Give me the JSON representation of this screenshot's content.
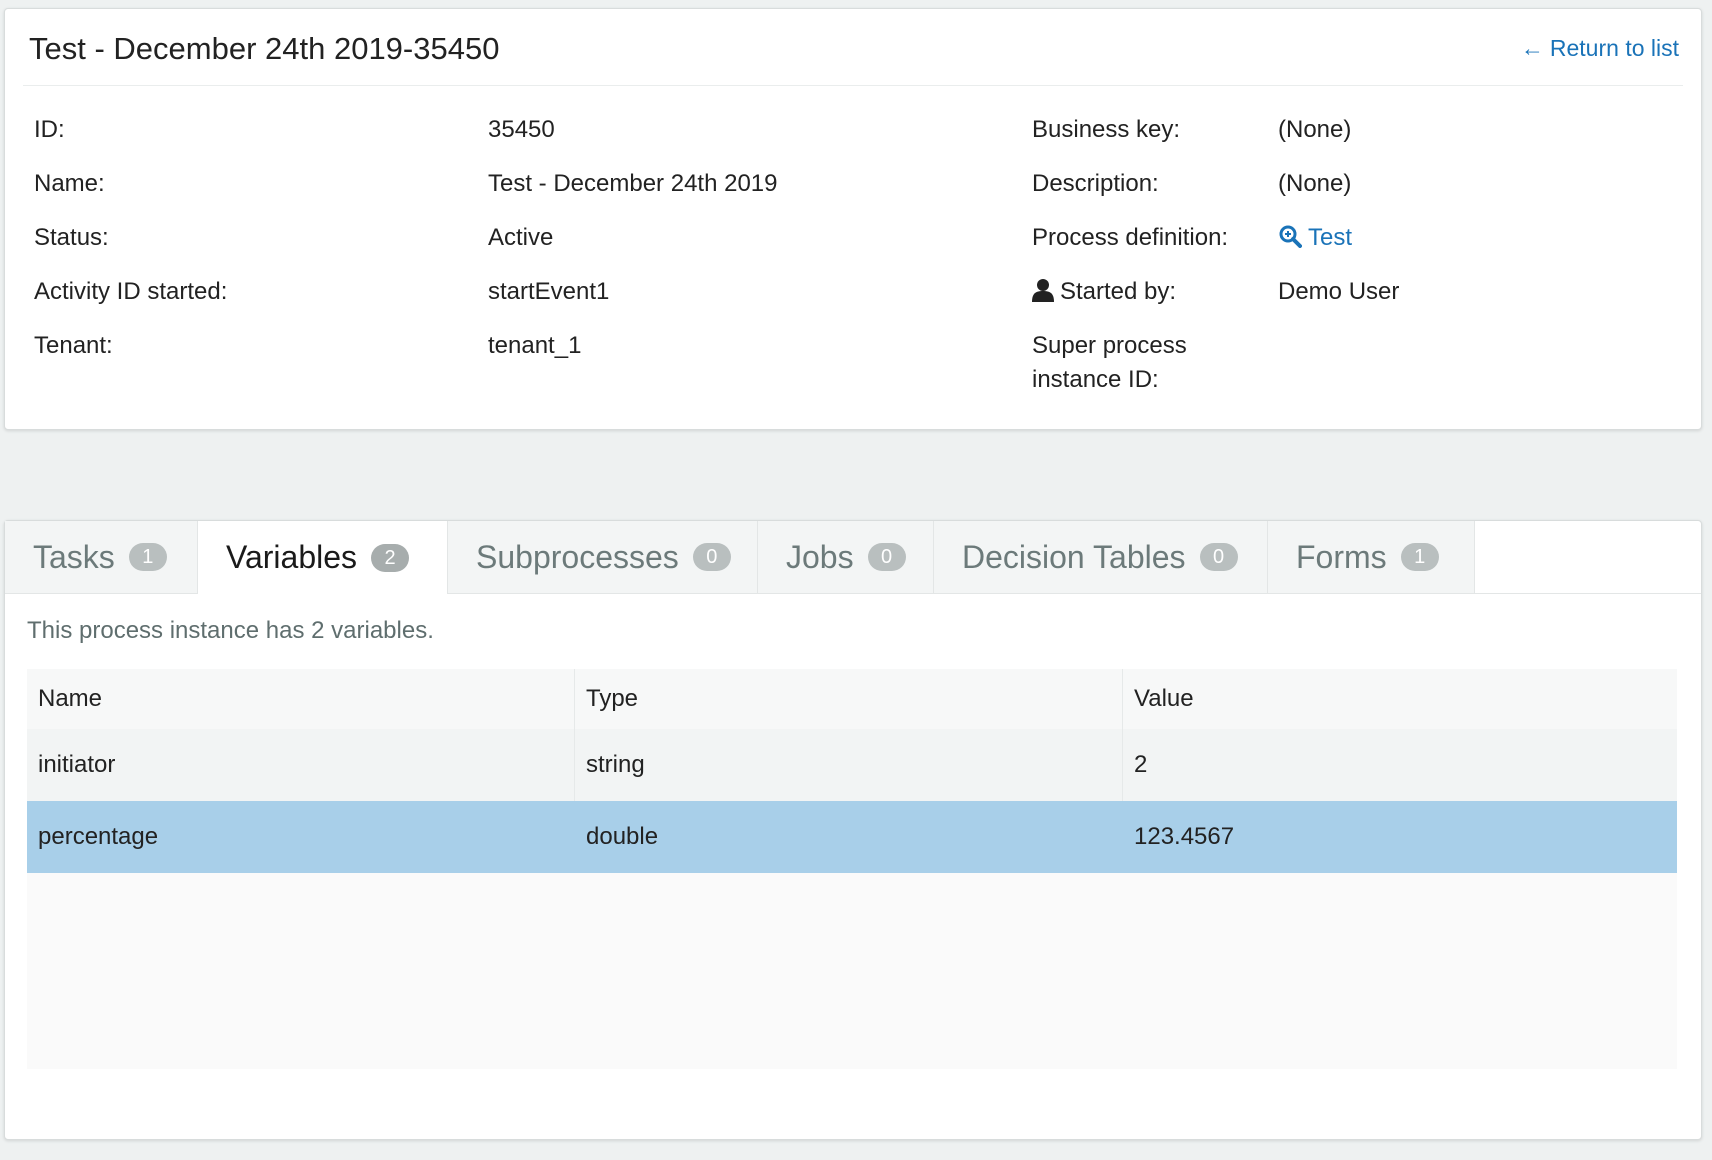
{
  "header": {
    "title": "Test - December 24th 2019-35450",
    "return_link": "Return to list"
  },
  "details": {
    "left": [
      {
        "label": "ID:",
        "value": "35450"
      },
      {
        "label": "Name:",
        "value": "Test - December 24th 2019"
      },
      {
        "label": "Status:",
        "value": "Active"
      },
      {
        "label": "Activity ID started:",
        "value": "startEvent1"
      },
      {
        "label": "Tenant:",
        "value": "tenant_1"
      }
    ],
    "right": [
      {
        "label": "Business key:",
        "value": "(None)"
      },
      {
        "label": "Description:",
        "value": "(None)"
      },
      {
        "label": "Process definition:",
        "value": "Test",
        "icon": "search-icon"
      },
      {
        "label": "Started by:",
        "value": "Demo User",
        "icon": "user-icon"
      },
      {
        "label_line1": "Super process",
        "label_line2": "instance ID:",
        "value": ""
      }
    ]
  },
  "tabs": [
    {
      "label": "Tasks",
      "count": "1"
    },
    {
      "label": "Variables",
      "count": "2",
      "active": true
    },
    {
      "label": "Subprocesses",
      "count": "0"
    },
    {
      "label": "Jobs",
      "count": "0"
    },
    {
      "label": "Decision Tables",
      "count": "0"
    },
    {
      "label": "Forms",
      "count": "1"
    }
  ],
  "variables": {
    "summary": "This process instance has 2 variables.",
    "columns": [
      "Name",
      "Type",
      "Value"
    ],
    "rows": [
      {
        "name": "initiator",
        "type": "string",
        "value": "2"
      },
      {
        "name": "percentage",
        "type": "double",
        "value": "123.4567",
        "selected": true
      }
    ]
  },
  "colors": {
    "link": "#1a73b8",
    "selected_row": "#a8cfe9",
    "badge": "#b9bfbf"
  }
}
